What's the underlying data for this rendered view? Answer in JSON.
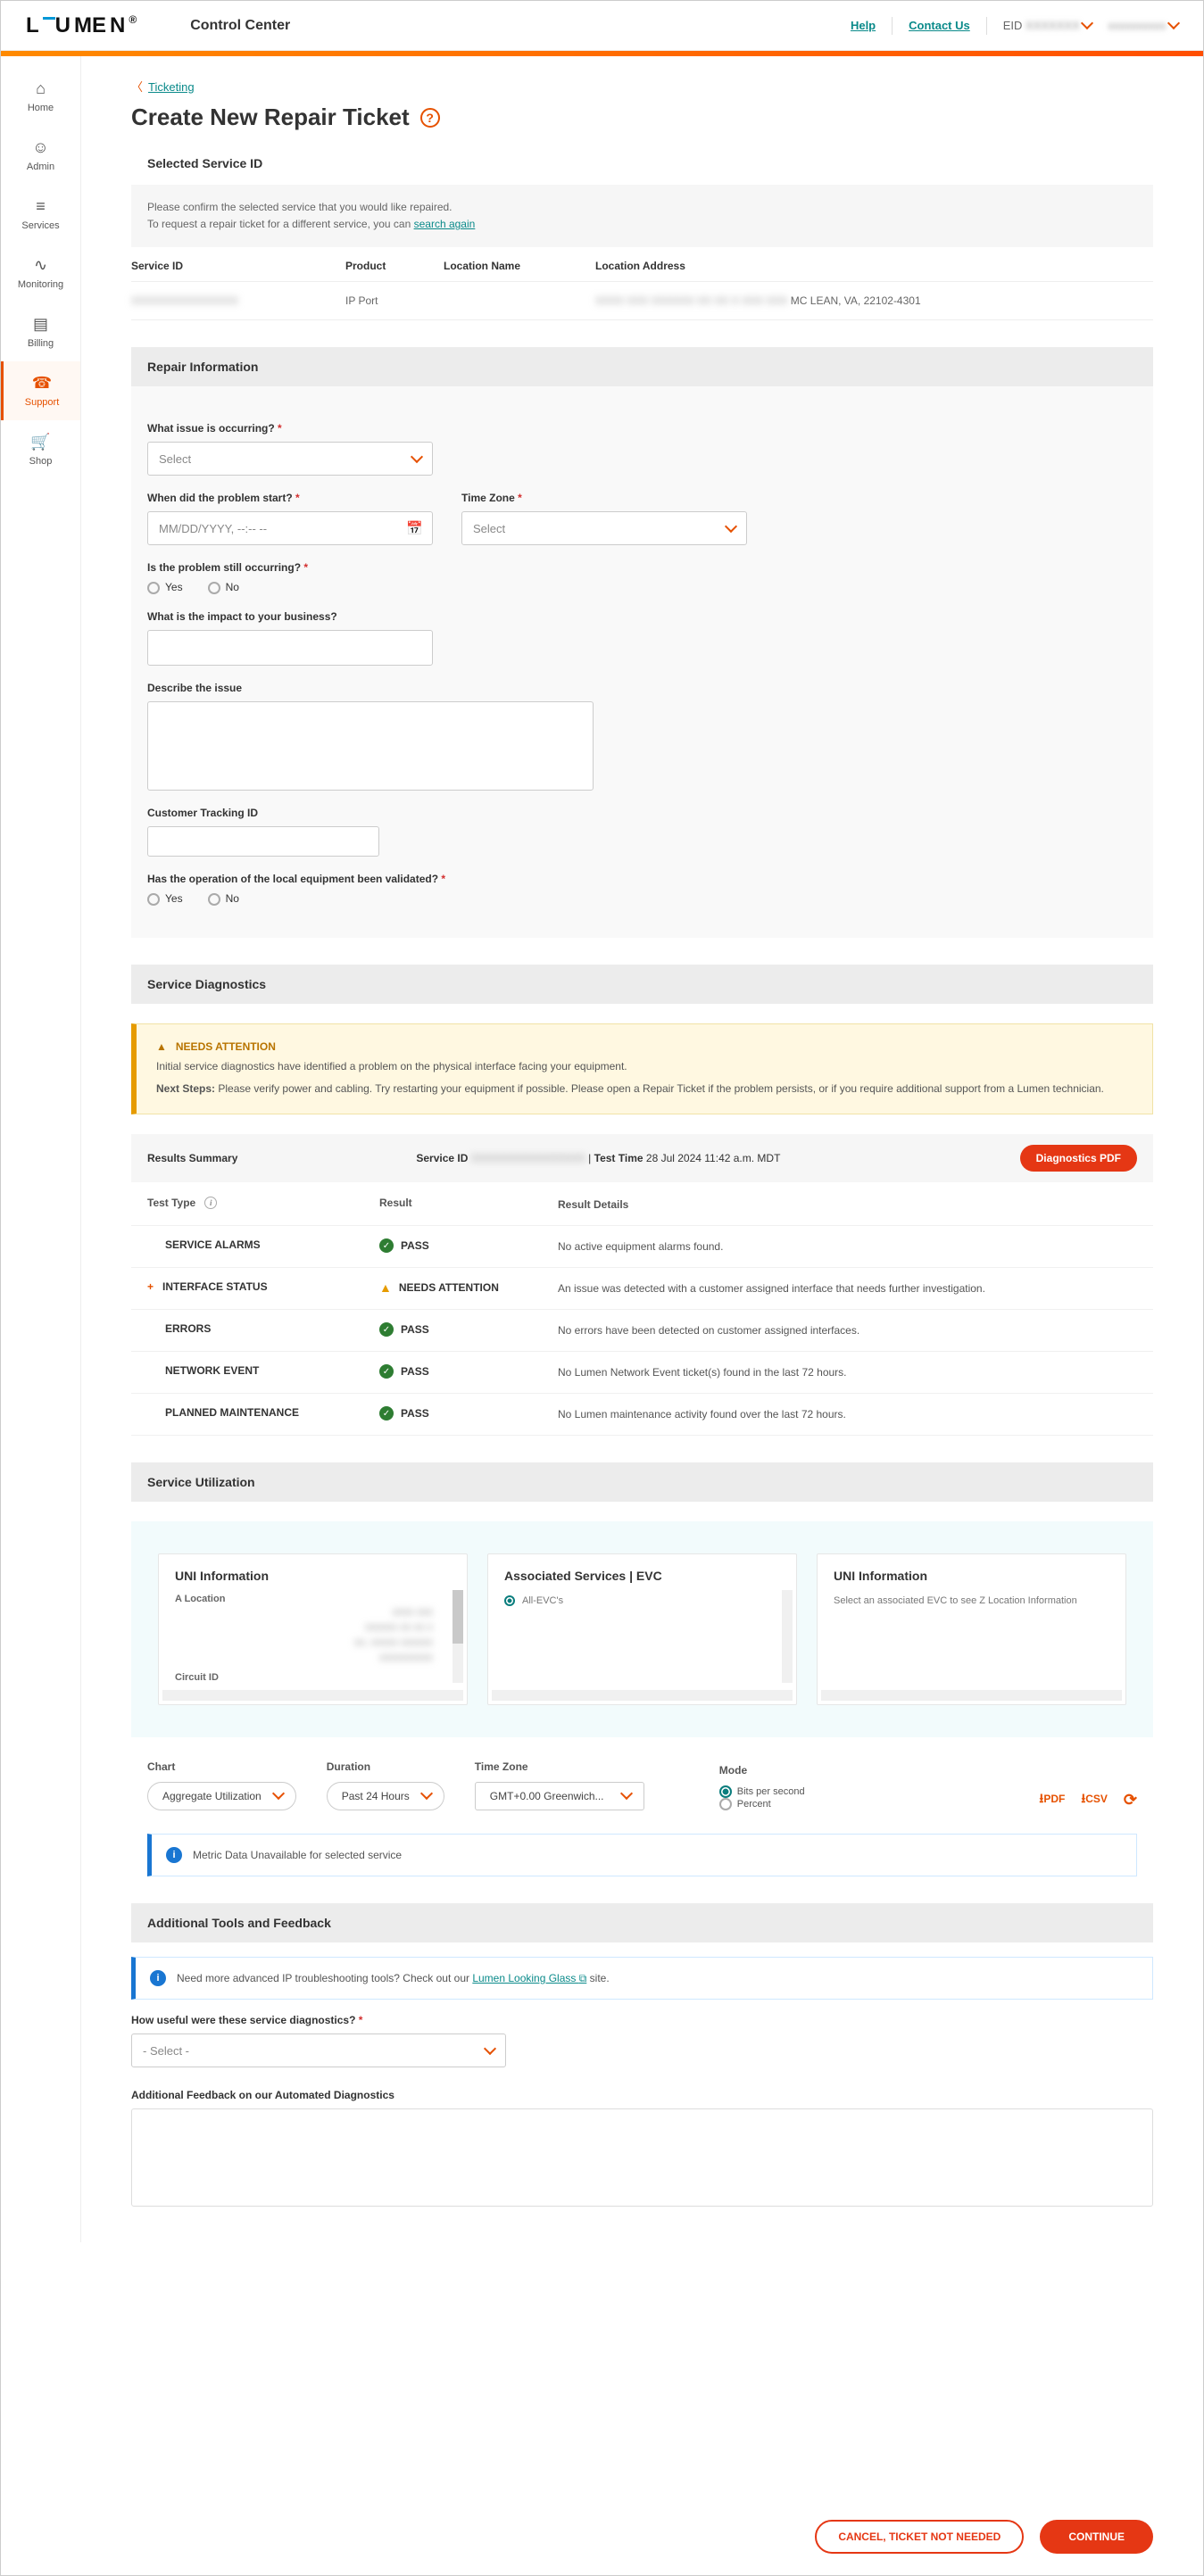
{
  "header": {
    "logo": "LUMEN",
    "subtitle": "Control Center",
    "help": "Help",
    "contact": "Contact Us",
    "eid_label": "EID",
    "eid_value": "XXXXXXX",
    "user": "xxxxxxxxxx"
  },
  "sidenav": [
    {
      "label": "Home",
      "icon": "⌂"
    },
    {
      "label": "Admin",
      "icon": "☺"
    },
    {
      "label": "Services",
      "icon": "≡"
    },
    {
      "label": "Monitoring",
      "icon": "∿"
    },
    {
      "label": "Billing",
      "icon": "▤"
    },
    {
      "label": "Support",
      "icon": "☎",
      "active": true
    },
    {
      "label": "Shop",
      "icon": "🛒"
    }
  ],
  "breadcrumb": {
    "back": "Ticketing"
  },
  "page_title": "Create New Repair Ticket",
  "selected_service": {
    "title": "Selected Service ID",
    "note1": "Please confirm the selected service that you would like repaired.",
    "note2a": "To request a repair ticket for a different service, you can ",
    "note2_link": "search again",
    "headers": {
      "sid": "Service ID",
      "prod": "Product",
      "lname": "Location Name",
      "laddr": "Location Address"
    },
    "row": {
      "sid": "XXXXXXXXXXXXXXX",
      "prod": "IP Port",
      "lname": "",
      "laddr_blur": "XXXX XXX XXXXXX XX XX X XXX XXX",
      "laddr_city": " MC LEAN, VA, 22102-4301"
    }
  },
  "repair": {
    "title": "Repair Information",
    "q_issue": "What issue is occurring?",
    "select": "Select",
    "q_when": "When did the problem start?",
    "date_ph": "MM/DD/YYYY, --:-- --",
    "q_tz": "Time Zone",
    "q_still": "Is the problem still occurring?",
    "yes": "Yes",
    "no": "No",
    "q_impact": "What is the impact to your business?",
    "q_desc": "Describe the issue",
    "q_track": "Customer Tracking ID",
    "q_valid": "Has the operation of the local equipment been validated?"
  },
  "diag": {
    "title": "Service Diagnostics",
    "attn_title": "NEEDS ATTENTION",
    "attn_body": "Initial service diagnostics have identified a problem on the physical interface facing your equipment.",
    "attn_next_label": "Next Steps:",
    "attn_next": "Please verify power and cabling. Try restarting your equipment if possible. Please open a Repair Ticket if the problem persists, or if you require additional support from a Lumen technician.",
    "summary_label": "Results Summary",
    "sid_label": "Service ID",
    "sid_value": "XXXXXXXXXXXXXXXX",
    "tt_label": "Test Time",
    "tt_value": "28 Jul 2024 11:42 a.m. MDT",
    "pdf": "Diagnostics PDF",
    "cols": {
      "type": "Test Type",
      "result": "Result",
      "details": "Result Details"
    },
    "rows": [
      {
        "type": "SERVICE ALARMS",
        "result": "PASS",
        "result_kind": "pass",
        "details": "No active equipment alarms found."
      },
      {
        "type": "INTERFACE STATUS",
        "expand": true,
        "result": "NEEDS ATTENTION",
        "result_kind": "warn",
        "details": "An issue was detected with a customer assigned interface that needs further investigation."
      },
      {
        "type": "ERRORS",
        "result": "PASS",
        "result_kind": "pass",
        "details": "No errors have been detected on customer assigned interfaces."
      },
      {
        "type": "NETWORK EVENT",
        "result": "PASS",
        "result_kind": "pass",
        "details": "No Lumen Network Event ticket(s) found in the last 72 hours."
      },
      {
        "type": "PLANNED MAINTENANCE",
        "result": "PASS",
        "result_kind": "pass",
        "details": "No Lumen maintenance activity found over the last 72 hours."
      }
    ]
  },
  "util": {
    "title": "Service Utilization",
    "card1": {
      "title": "UNI Information",
      "l1": "A Location",
      "l2": "Circuit ID"
    },
    "card2": {
      "title": "Associated Services | EVC",
      "item": "All-EVC's"
    },
    "card3": {
      "title": "UNI Information",
      "body": "Select an associated EVC to see Z Location Information"
    },
    "chart_l": "Chart",
    "chart_v": "Aggregate Utilization",
    "dur_l": "Duration",
    "dur_v": "Past 24 Hours",
    "tz_l": "Time Zone",
    "tz_v": "GMT+0.00 Greenwich...",
    "mode_l": "Mode",
    "mode_a": "Bits per second",
    "mode_b": "Percent",
    "pdf": "PDF",
    "csv": "CSV",
    "banner": "Metric Data Unavailable for selected service"
  },
  "tools": {
    "title": "Additional Tools and Feedback",
    "banner_a": "Need more advanced IP troubleshooting tools? Check out our ",
    "banner_link": "Lumen Looking Glass ",
    "banner_b": " site.",
    "q_useful": "How useful were these service diagnostics?",
    "sel": "- Select -",
    "q_fb": "Additional Feedback on our Automated Diagnostics"
  },
  "footer": {
    "cancel": "CANCEL, TICKET NOT NEEDED",
    "cont": "CONTINUE"
  }
}
